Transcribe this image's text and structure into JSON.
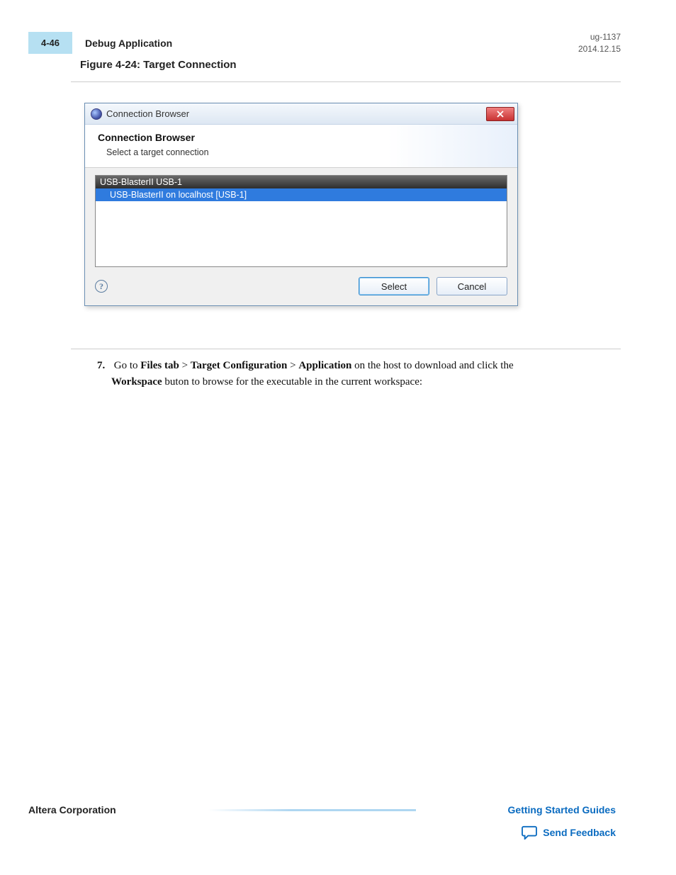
{
  "header": {
    "page_num": "4-46",
    "section": "Debug Application",
    "doc_id": "ug-1137",
    "doc_date": "2014.12.15"
  },
  "figure": {
    "caption": "Figure 4-24: Target Connection"
  },
  "dialog": {
    "title": "Connection Browser",
    "header_title": "Connection Browser",
    "header_sub": "Select a target connection",
    "group": "USB-BlasterII USB-1",
    "item": "USB-BlasterII on localhost [USB-1]",
    "select_btn": "Select",
    "cancel_btn": "Cancel"
  },
  "step": {
    "num": "7.",
    "t1": "Go to ",
    "b1": "Files tab",
    "t2": " > ",
    "b2": "Target Configuration",
    "t3": " > ",
    "b3": "Application",
    "t4": " on the host to download and click the ",
    "b4": "Workspace",
    "t5": " buton to browse for the executable in the current workspace:"
  },
  "footer": {
    "company": "Altera Corporation",
    "guides": "Getting Started Guides",
    "feedback": "Send Feedback"
  }
}
